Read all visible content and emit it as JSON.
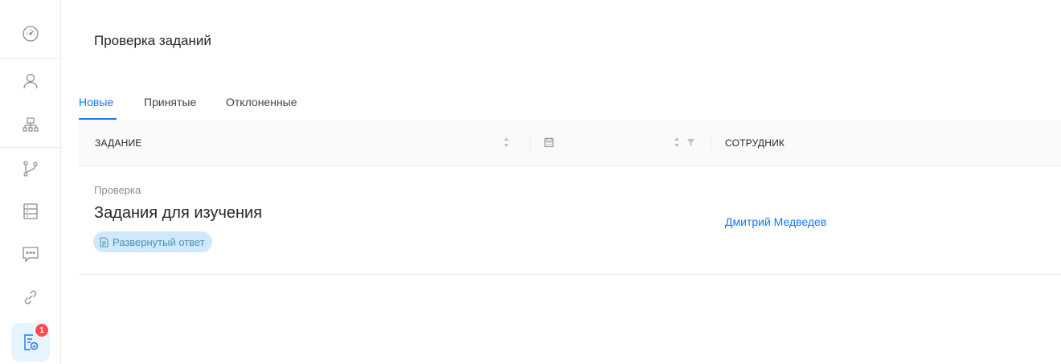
{
  "sidebar": {
    "items": [
      {
        "icon": "dashboard-icon"
      },
      {
        "icon": "user-icon"
      },
      {
        "icon": "org-structure-icon"
      },
      {
        "icon": "branch-icon"
      },
      {
        "icon": "database-icon"
      },
      {
        "icon": "chat-icon"
      },
      {
        "icon": "link-icon"
      },
      {
        "icon": "task-check-icon",
        "badge": "1",
        "active": true
      }
    ]
  },
  "page": {
    "title": "Проверка заданий"
  },
  "tabs": [
    {
      "label": "Новые",
      "active": true
    },
    {
      "label": "Принятые"
    },
    {
      "label": "Отклоненные"
    }
  ],
  "table": {
    "columns": {
      "task": "Задание",
      "employee": "Сотрудник"
    },
    "rows": [
      {
        "category": "Проверка",
        "title": "Задания для изучения",
        "tag": "Развернутый ответ",
        "employee": "Дмитрий Медведев"
      }
    ]
  },
  "colors": {
    "accent": "#1677ff",
    "badge": "#ff4d4f",
    "tag_bg": "#cfe9fb"
  }
}
